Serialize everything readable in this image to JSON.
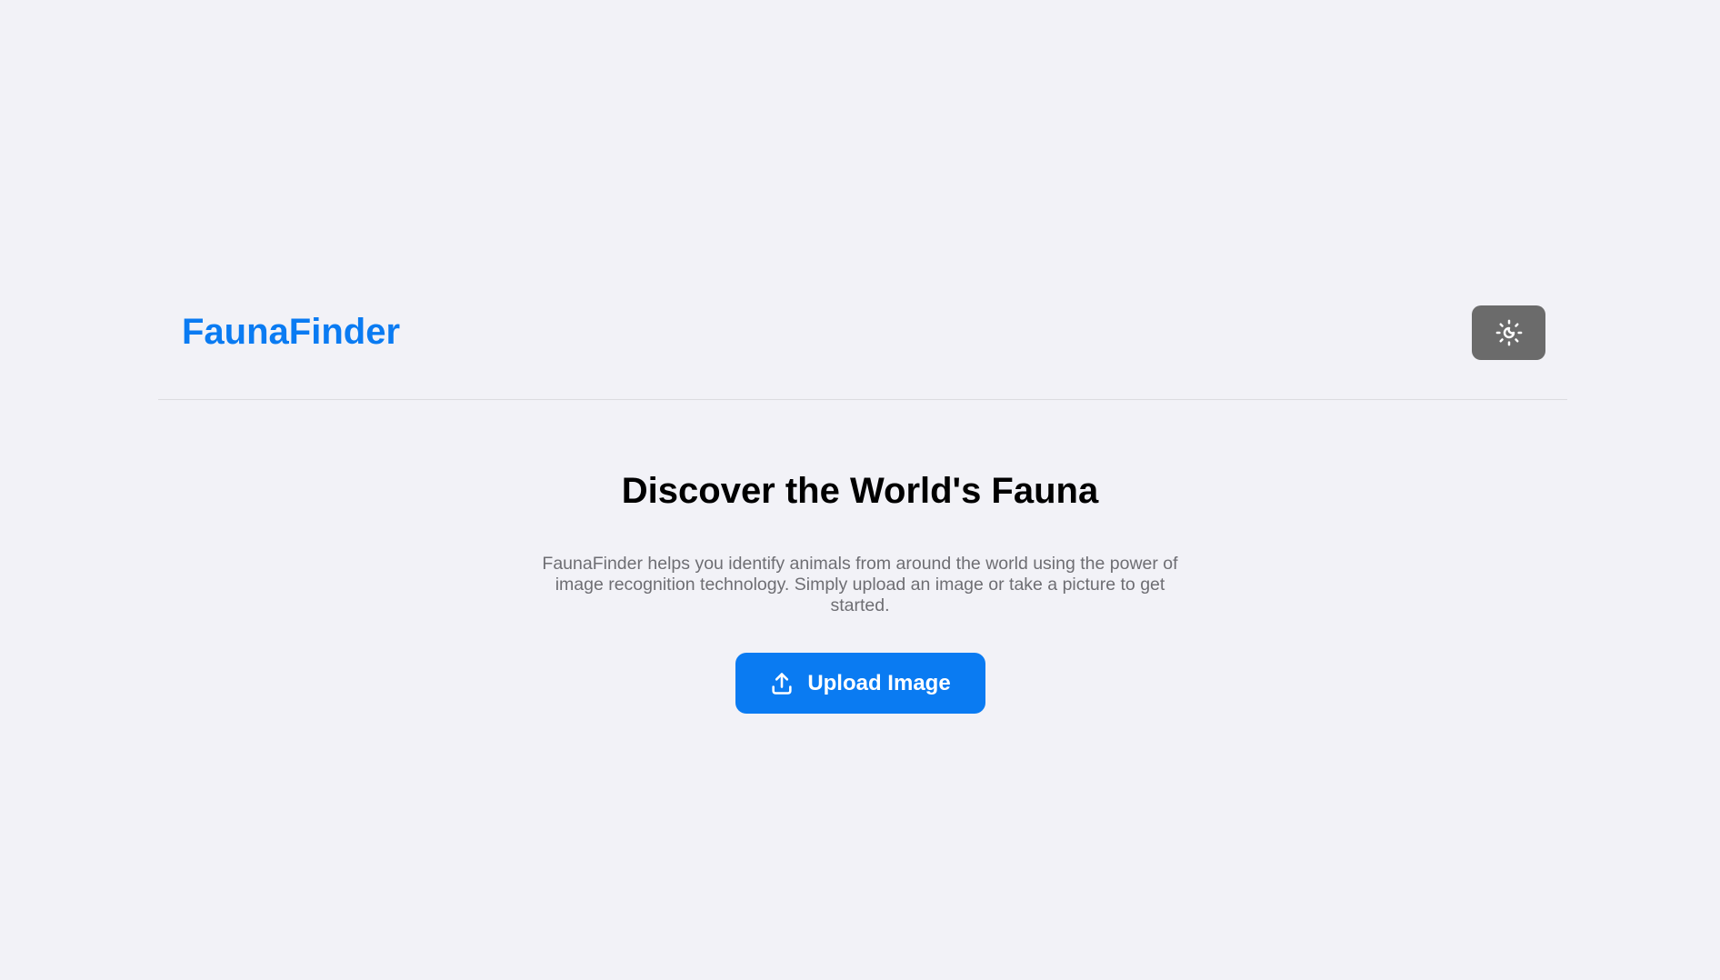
{
  "header": {
    "logo": "FaunaFinder",
    "theme_toggle_icon": "theme-toggle-sun-moon-icon"
  },
  "hero": {
    "title": "Discover the World's Fauna",
    "description": "FaunaFinder helps you identify animals from around the world using the power of image recognition technology. Simply upload an image or take a picture to get started.",
    "upload_button_label": "Upload Image",
    "upload_icon": "upload-icon"
  },
  "colors": {
    "background": "#f2f2f7",
    "accent": "#0a7bf2",
    "toggle_background": "#6b6b6b",
    "description_text": "#6e6e73"
  }
}
